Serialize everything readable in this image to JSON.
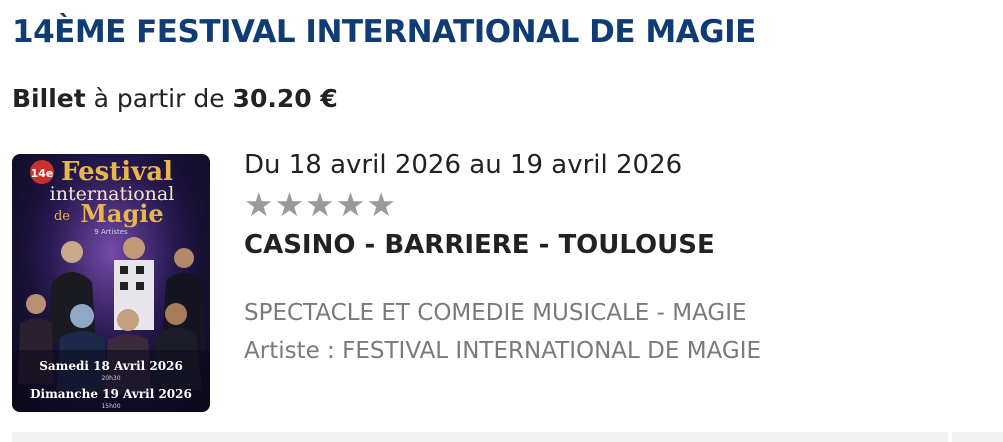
{
  "event": {
    "title": "14ÈME FESTIVAL INTERNATIONAL DE MAGIE",
    "price_prefix": "Billet",
    "price_middle": "à partir de",
    "price_value": "30.20 €",
    "dates": "Du 18 avril 2026 au 19 avril 2026",
    "rating_stars": "★★★★★",
    "venue": "CASINO - BARRIERE - TOULOUSE",
    "category": "SPECTACLE ET COMEDIE MUSICALE - MAGIE",
    "artist": "Artiste : FESTIVAL INTERNATIONAL DE MAGIE"
  },
  "poster": {
    "edition": "14e",
    "line1": "Festival",
    "line2": "international",
    "line3": "de",
    "line4": "Magie",
    "artists_note": "9 Artistes",
    "date1": "Samedi 18 Avril 2026",
    "time1": "20h30",
    "date2": "Dimanche 19 Avril 2026",
    "time2": "15h00"
  },
  "colors": {
    "title": "#0f3c73",
    "stars": "#9a9a9a",
    "secondary_text": "#7a7a7a",
    "poster_gold": "#e8b64a"
  }
}
